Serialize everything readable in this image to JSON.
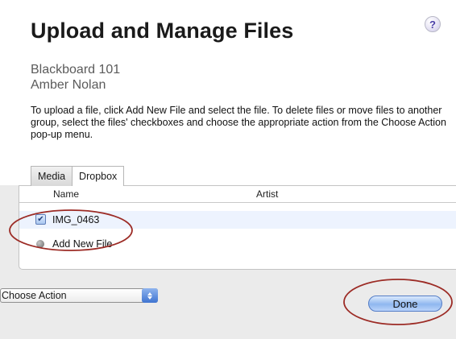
{
  "header": {
    "title": "Upload and Manage Files",
    "help_label": "?"
  },
  "context": {
    "course": "Blackboard 101",
    "user": "Amber Nolan"
  },
  "instructions": "To upload a file, click Add New File and select the file. To delete files or move files to another group, select the files' checkboxes and choose the appropriate action from the Choose Action pop-up menu.",
  "tabs": [
    {
      "label": "Media",
      "active": true
    },
    {
      "label": "Dropbox",
      "active": false
    }
  ],
  "file_list": {
    "columns": [
      "Name",
      "Artist"
    ],
    "rows": [
      {
        "name": "IMG_0463",
        "checked": true
      }
    ],
    "add_new_label": "Add New File"
  },
  "footer": {
    "action_selected": "Choose Action",
    "done_label": "Done"
  },
  "colors": {
    "annotation_ring": "#9c2b25",
    "accent_blue": "#3f74d1"
  },
  "icons": {
    "help": "help-icon",
    "checkbox": "checkbox-icon",
    "add": "add-file-icon",
    "stepper": "up-down-arrows-icon"
  }
}
